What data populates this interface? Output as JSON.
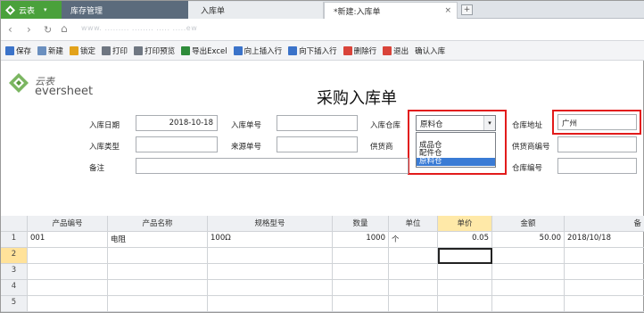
{
  "tabs": {
    "app": "云表",
    "tab1": "库存管理",
    "tab2": "入库单",
    "tab3": "*新建:入库单",
    "close": "×",
    "new_tab": "+"
  },
  "nav": {
    "back": "‹",
    "forward": "›",
    "refresh": "↻",
    "home": "⌂",
    "address": "www. ......... ........ ..... .....ew"
  },
  "toolbar": [
    {
      "label": "保存",
      "icon": "save-icon",
      "color": "#3b73c9"
    },
    {
      "label": "新建",
      "icon": "new-icon",
      "color": "#6a8fbf"
    },
    {
      "label": "锁定",
      "icon": "lock-icon",
      "color": "#e2a21b"
    },
    {
      "label": "打印",
      "icon": "print-icon",
      "color": "#6f7782"
    },
    {
      "label": "打印预览",
      "icon": "print-preview-icon",
      "color": "#6f7782"
    },
    {
      "label": "导出Excel",
      "icon": "excel-icon",
      "color": "#2e8b3a"
    },
    {
      "label": "向上插入行",
      "icon": "insert-above-icon",
      "color": "#3b73c9"
    },
    {
      "label": "向下插入行",
      "icon": "insert-below-icon",
      "color": "#3b73c9"
    },
    {
      "label": "删除行",
      "icon": "delete-row-icon",
      "color": "#d9443a"
    },
    {
      "label": "退出",
      "icon": "exit-icon",
      "color": "#d9443a"
    },
    {
      "label": "确认入库",
      "icon": "",
      "color": ""
    }
  ],
  "logo": {
    "cn": "云表",
    "en": "eversheet"
  },
  "form": {
    "title": "采购入库单",
    "date_label": "入库日期",
    "date_value": "2018-10-18",
    "no_label": "入库单号",
    "no_value": "",
    "warehouse_label": "入库仓库",
    "warehouse_value": "原料仓",
    "warehouse_options": [
      "成品仓",
      "配件仓",
      "原料仓"
    ],
    "address_label": "仓库地址",
    "address_value": "广州",
    "type_label": "入库类型",
    "type_value": "",
    "source_label": "来源单号",
    "source_value": "",
    "supplier_label": "供货商",
    "supplier_no_label": "供货商编号",
    "supplier_no_value": "",
    "remark_label": "备注",
    "remark_value": "",
    "warehouse_no_label": "仓库编号",
    "warehouse_no_value": ""
  },
  "grid": {
    "headers": [
      "产品编号",
      "产品名称",
      "规格型号",
      "数量",
      "单位",
      "单价",
      "金额",
      "备"
    ],
    "row_numbers": [
      "1",
      "2",
      "3",
      "4",
      "5"
    ],
    "rows": [
      [
        "001",
        "电阻",
        "100Ω",
        "1000",
        "个",
        "0.05",
        "50.00",
        "2018/10/18"
      ]
    ]
  }
}
